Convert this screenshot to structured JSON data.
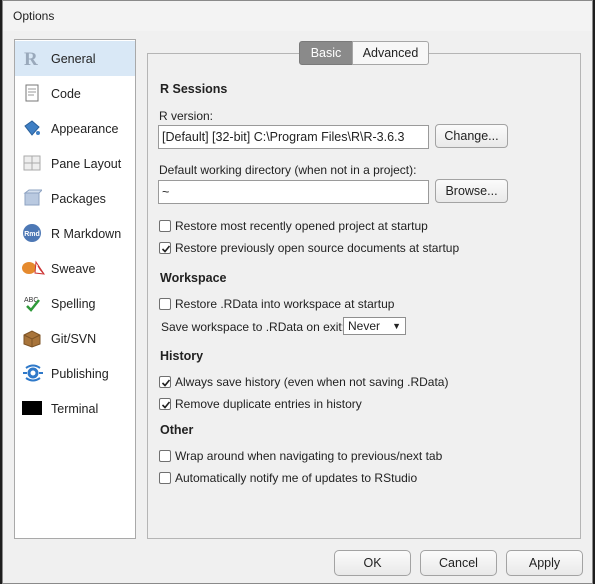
{
  "window": {
    "title": "Options"
  },
  "sidebar": {
    "items": [
      {
        "label": "General",
        "icon": "r-logo-icon",
        "selected": true
      },
      {
        "label": "Code",
        "icon": "document-icon"
      },
      {
        "label": "Appearance",
        "icon": "paint-bucket-icon"
      },
      {
        "label": "Pane Layout",
        "icon": "grid-layout-icon"
      },
      {
        "label": "Packages",
        "icon": "package-icon"
      },
      {
        "label": "R Markdown",
        "icon": "rmd-icon",
        "icon_text": "Rmd"
      },
      {
        "label": "Sweave",
        "icon": "sweave-icon"
      },
      {
        "label": "Spelling",
        "icon": "spellcheck-icon",
        "icon_text": "ABC"
      },
      {
        "label": "Git/SVN",
        "icon": "box-icon"
      },
      {
        "label": "Publishing",
        "icon": "publish-icon"
      },
      {
        "label": "Terminal",
        "icon": "terminal-icon"
      }
    ]
  },
  "tabs": {
    "basic": "Basic",
    "advanced": "Advanced"
  },
  "r_sessions": {
    "title": "R Sessions",
    "r_version_label": "R version:",
    "r_version_value": "[Default] [32-bit] C:\\Program Files\\R\\R-3.6.3",
    "change_button": "Change...",
    "wd_label": "Default working directory (when not in a project):",
    "wd_value": "~",
    "browse_button": "Browse...",
    "restore_project": {
      "label": "Restore most recently opened project at startup",
      "checked": false
    },
    "restore_docs": {
      "label": "Restore previously open source documents at startup",
      "checked": true
    }
  },
  "workspace": {
    "title": "Workspace",
    "restore_rdata": {
      "label": "Restore .RData into workspace at startup",
      "checked": false
    },
    "save_label": "Save workspace to .RData on exit:",
    "save_value": "Never"
  },
  "history": {
    "title": "History",
    "always_save": {
      "label": "Always save history (even when not saving .RData)",
      "checked": true
    },
    "remove_dups": {
      "label": "Remove duplicate entries in history",
      "checked": true
    }
  },
  "other": {
    "title": "Other",
    "wrap_around": {
      "label": "Wrap around when navigating to previous/next tab",
      "checked": false
    },
    "notify_updates": {
      "label": "Automatically notify me of updates to RStudio",
      "checked": false
    }
  },
  "footer": {
    "ok": "OK",
    "cancel": "Cancel",
    "apply": "Apply"
  }
}
